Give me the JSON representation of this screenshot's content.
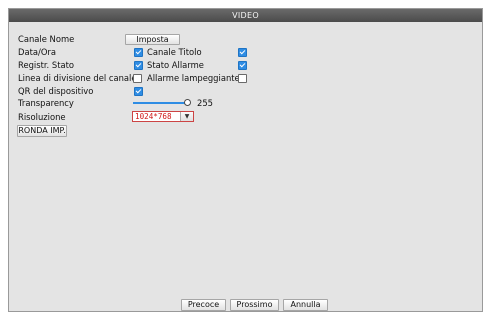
{
  "window": {
    "title": "VIDEO"
  },
  "fields": {
    "channel_name_label": "Canale Nome",
    "channel_name_button": "Imposta",
    "date_time_label": "Data/Ora",
    "channel_title_label": "Canale Titolo",
    "record_status_label": "Registr. Stato",
    "alarm_status_label": "Stato Allarme",
    "channel_divider_label": "Linea di divisione del canale",
    "flashing_alarm_label": "Allarme lampeggiante",
    "device_qr_label": "QR del dispositivo",
    "transparency_label": "Transparency",
    "transparency_value": "255",
    "resolution_label": "Risoluzione",
    "resolution_value": "1024*768",
    "tour_button": "RONDA IMP."
  },
  "checkboxes": {
    "date_time": true,
    "channel_title": true,
    "record_status": true,
    "alarm_status": true,
    "channel_divider": false,
    "flashing_alarm": false,
    "device_qr": true
  },
  "footer": {
    "prev_label": "Precoce",
    "next_label": "Prossimo",
    "cancel_label": "Annulla"
  },
  "colors": {
    "titlebar": "#555555",
    "accent": "#2f8de4",
    "resolution_text": "#d01818"
  }
}
